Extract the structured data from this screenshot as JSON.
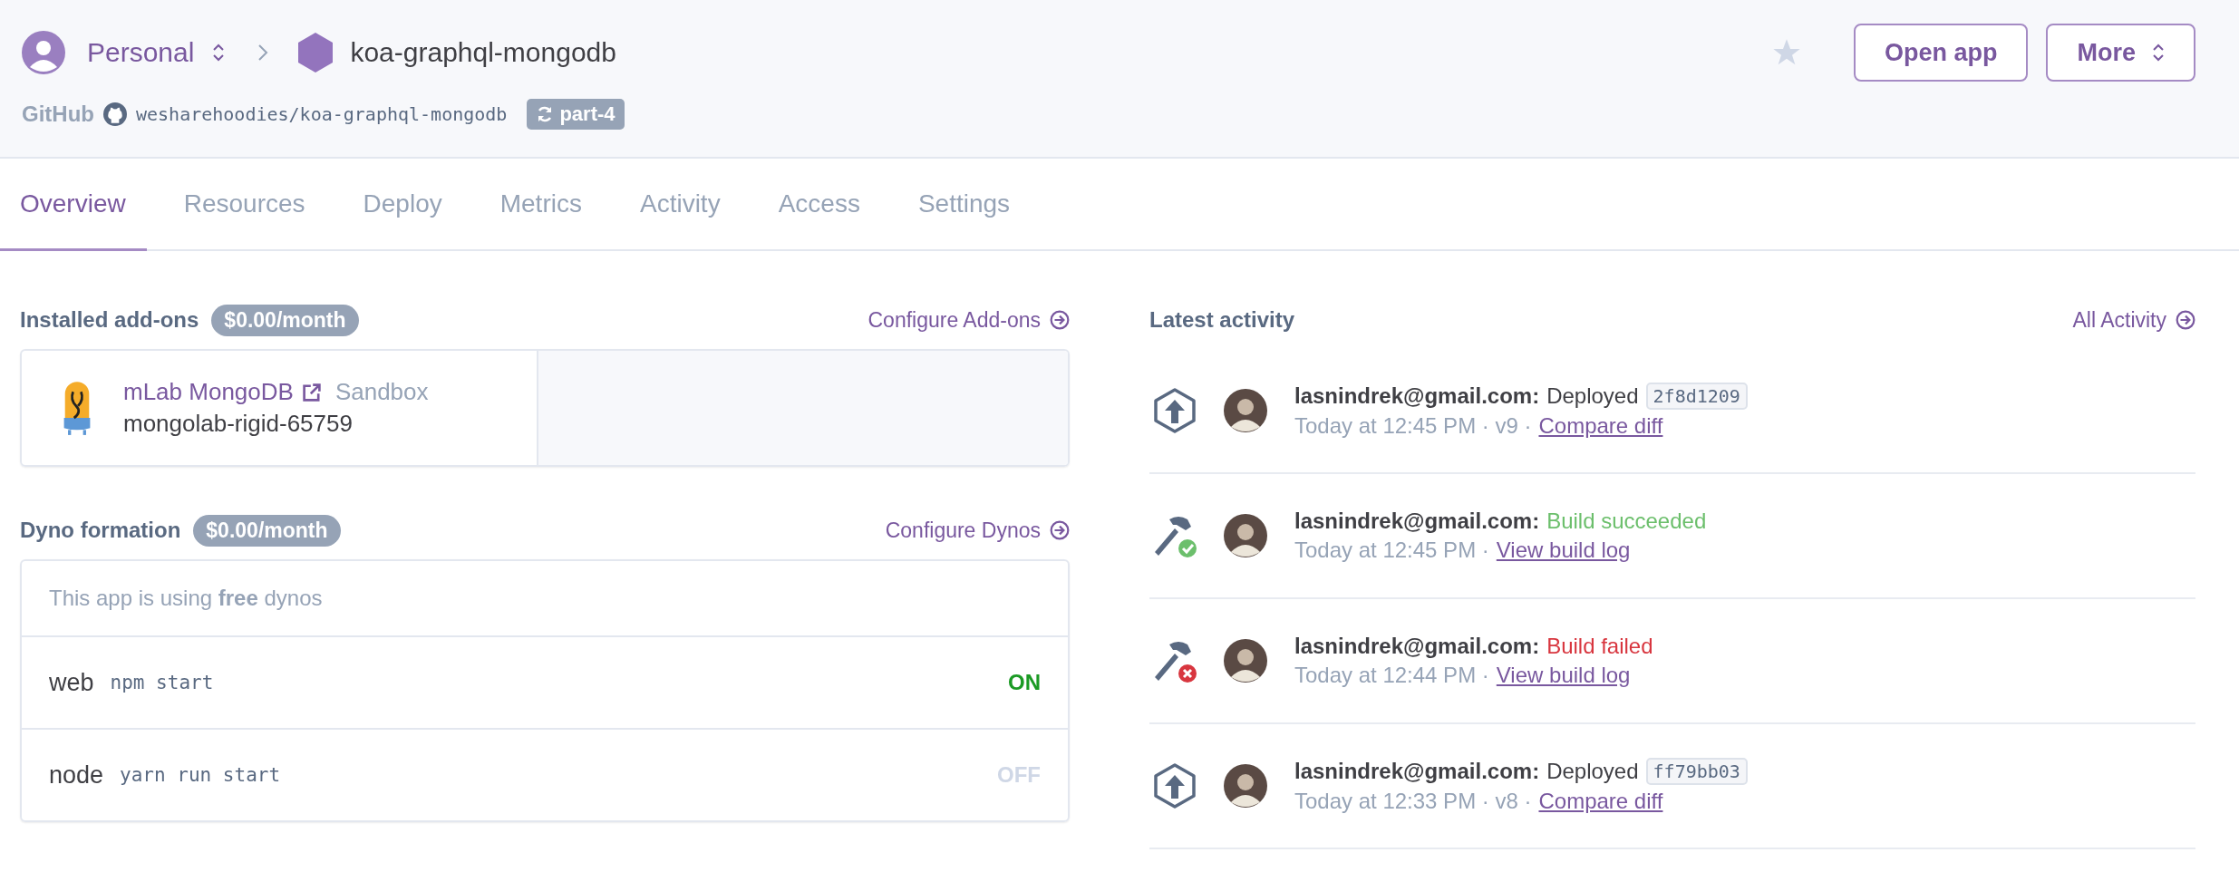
{
  "header": {
    "account": "Personal",
    "app_name": "koa-graphql-mongodb",
    "source_label": "GitHub",
    "repo": "wesharehoodies/koa-graphql-mongodb",
    "branch": "part-4",
    "starred": false,
    "buttons": [
      {
        "label": "Open app",
        "kind": "plain"
      },
      {
        "label": "More",
        "kind": "menu"
      }
    ]
  },
  "tabs": [
    {
      "label": "Overview",
      "selected": true
    },
    {
      "label": "Resources",
      "selected": false
    },
    {
      "label": "Deploy",
      "selected": false
    },
    {
      "label": "Metrics",
      "selected": false
    },
    {
      "label": "Activity",
      "selected": false
    },
    {
      "label": "Access",
      "selected": false
    },
    {
      "label": "Settings",
      "selected": false
    }
  ],
  "addons": {
    "title": "Installed add-ons",
    "cost": "$0.00/month",
    "link": "Configure Add-ons",
    "items": [
      {
        "name": "mLab MongoDB",
        "plan": "Sandbox",
        "instance": "mongolab-rigid-65759"
      }
    ]
  },
  "dynos": {
    "title": "Dyno formation",
    "cost": "$0.00/month",
    "link": "Configure Dynos",
    "note": "This app is using **free** dynos",
    "items": [
      {
        "name": "web",
        "command": "npm start",
        "state": "ON",
        "on": true
      },
      {
        "name": "node",
        "command": "yarn run start",
        "state": "OFF",
        "on": false
      }
    ]
  },
  "activity": {
    "title": "Latest activity",
    "link": "All Activity",
    "items": [
      {
        "kind": "deploy",
        "user": "lasnindrek@gmail.com:",
        "message": "Deployed",
        "commit": "2f8d1209",
        "meta": "Today at 12:45 PM · v9 ·",
        "link": "Compare diff"
      },
      {
        "kind": "build",
        "user": "lasnindrek@gmail.com:",
        "message": "Build succeeded",
        "succeeded": true,
        "meta": "Today at 12:45 PM ·",
        "link": "View build log"
      },
      {
        "kind": "build",
        "user": "lasnindrek@gmail.com:",
        "message": "Build failed",
        "succeeded": false,
        "meta": "Today at 12:44 PM ·",
        "link": "View build log"
      },
      {
        "kind": "deploy",
        "user": "lasnindrek@gmail.com:",
        "message": "Deployed",
        "commit": "ff79bb03",
        "meta": "Today at 12:33 PM · v8 ·",
        "link": "Compare diff"
      }
    ]
  }
}
